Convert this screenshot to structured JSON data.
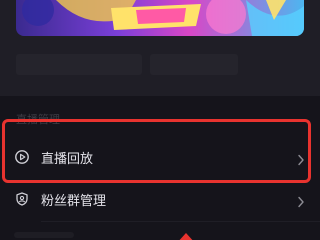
{
  "live_card": {
    "title": "",
    "tag": "",
    "desc_left": "",
    "desc_right": ""
  },
  "section": {
    "label": "直播管理"
  },
  "rows": [
    {
      "label": "直播回放",
      "icon": "play-circle-icon"
    },
    {
      "label": "粉丝群管理",
      "icon": "fan-group-icon"
    }
  ],
  "colors": {
    "background": "#15141b",
    "card": "#1f1e26",
    "text_primary": "#e4e3ea",
    "highlight": "#e8332f"
  }
}
